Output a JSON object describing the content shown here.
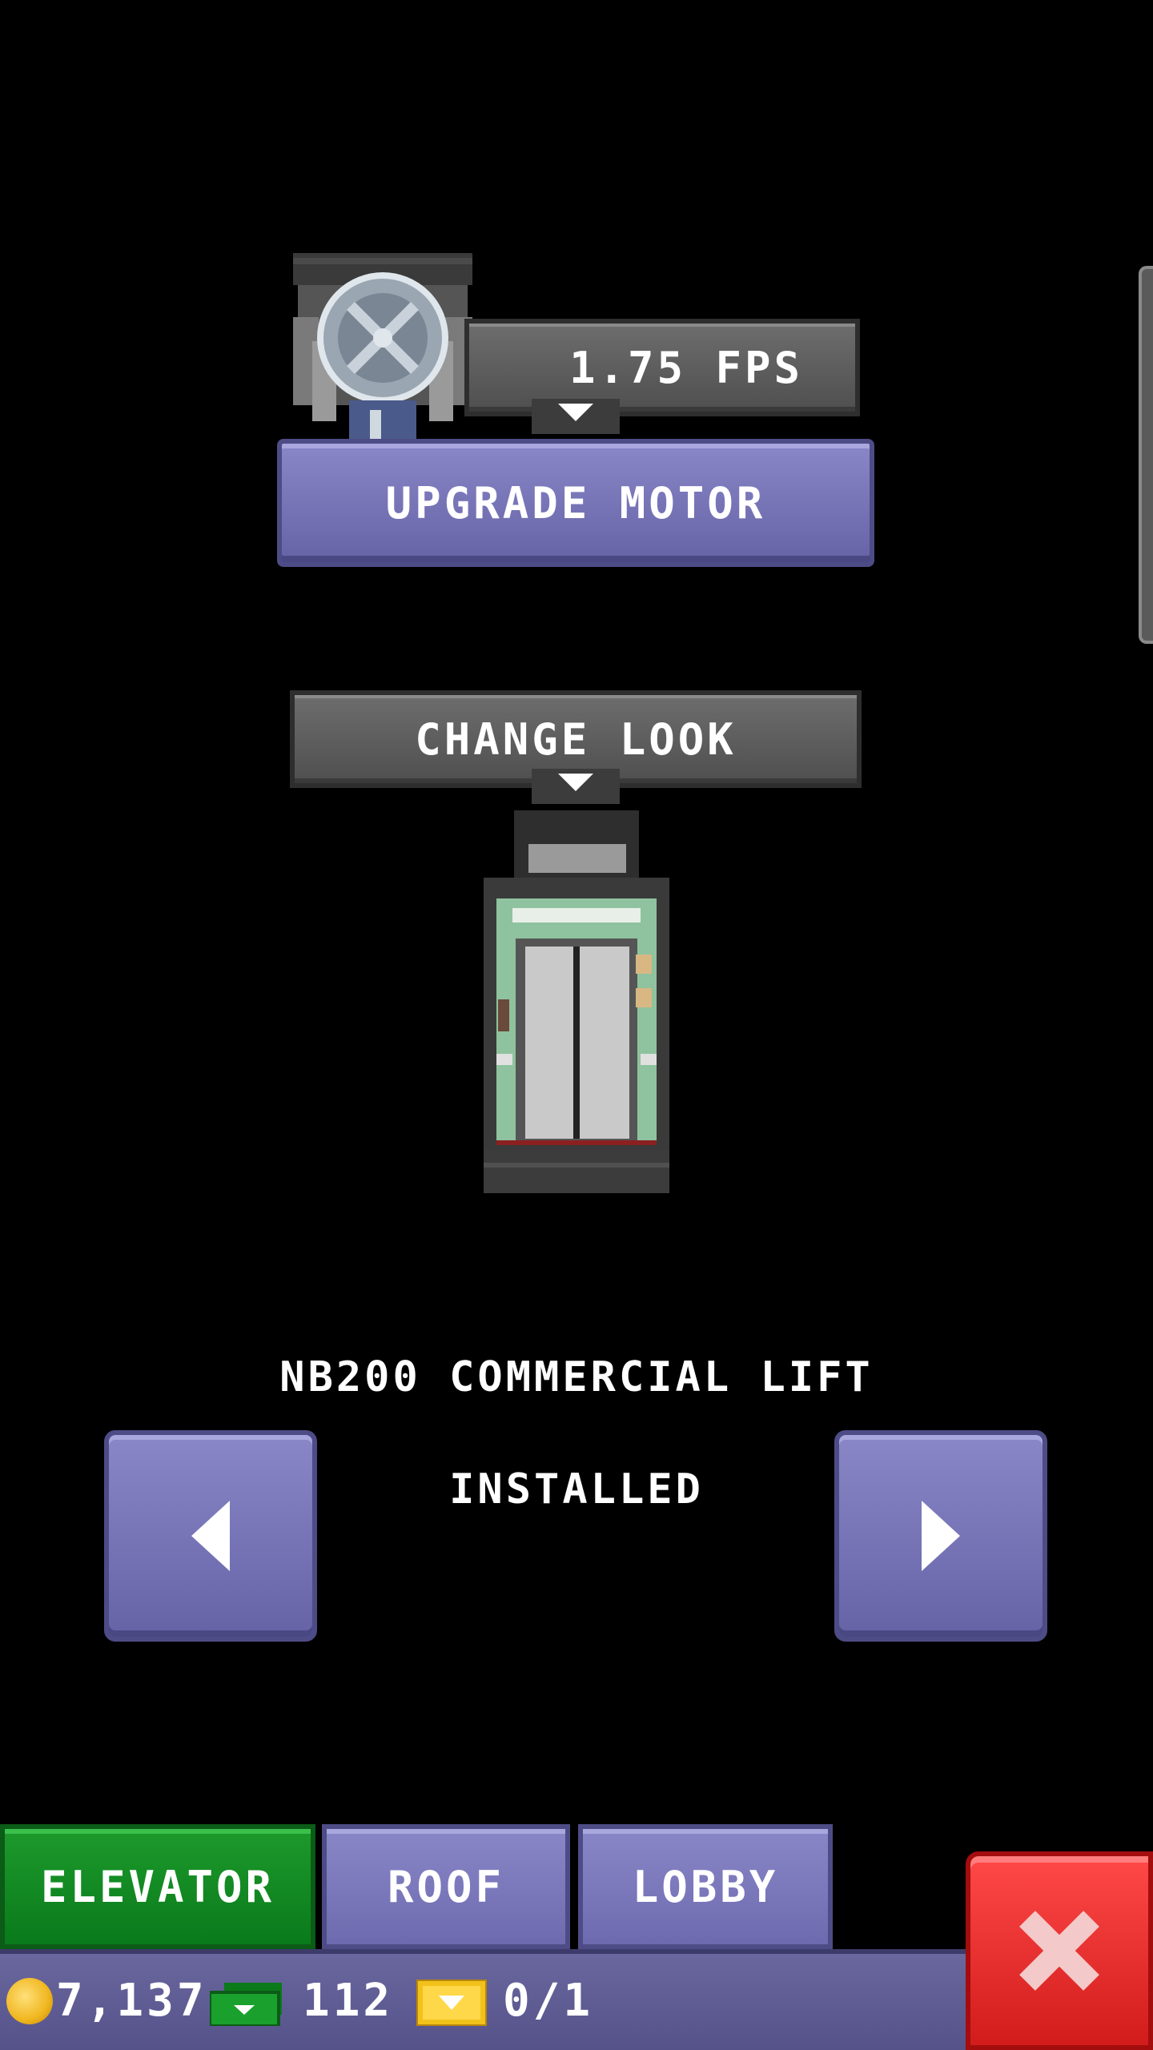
{
  "motor": {
    "speed_readout": "1.75 FPS",
    "upgrade_label": "UPGRADE MOTOR"
  },
  "look": {
    "change_label": "CHANGE LOOK"
  },
  "elevator": {
    "model_name": "NB200 COMMERCIAL LIFT",
    "status": "INSTALLED"
  },
  "tabs": [
    {
      "label": "ELEVATOR",
      "active": true
    },
    {
      "label": "ROOF",
      "active": false
    },
    {
      "label": "LOBBY",
      "active": false
    }
  ],
  "currency": {
    "coins": "7,137",
    "bux": "112",
    "tickets": "0/1"
  },
  "icons": {
    "prev": "chevron-left-icon",
    "next": "chevron-right-icon",
    "close": "close-icon",
    "coin": "coin-icon",
    "bux": "cash-icon",
    "ticket": "ticket-icon"
  },
  "colors": {
    "background": "#000000",
    "button_purple": "#7a77bd",
    "tab_active_green": "#0f8a21",
    "close_red": "#e32626"
  }
}
